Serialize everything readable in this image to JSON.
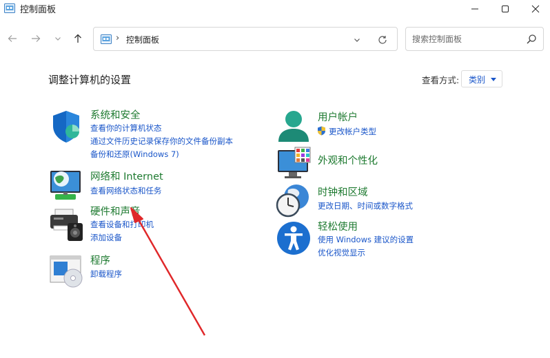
{
  "window": {
    "title": "控制面板",
    "controls": {
      "minimize_icon": "minimize-icon",
      "maximize_icon": "maximize-icon",
      "close_icon": "close-icon"
    }
  },
  "nav": {
    "address_path": "控制面板",
    "search_placeholder": "搜索控制面板"
  },
  "main": {
    "heading": "调整计算机的设置",
    "view_by_label": "查看方式:",
    "view_by_value": "类别"
  },
  "categories_left": [
    {
      "icon": "shield-icon",
      "title": "系统和安全",
      "links": [
        "查看你的计算机状态",
        "通过文件历史记录保存你的文件备份副本",
        "备份和还原(Windows 7)"
      ]
    },
    {
      "icon": "network-globe-icon",
      "title": "网络和 Internet",
      "links": [
        "查看网络状态和任务"
      ]
    },
    {
      "icon": "printer-speaker-icon",
      "title": "硬件和声音",
      "links": [
        "查看设备和打印机",
        "添加设备"
      ]
    },
    {
      "icon": "programs-disc-icon",
      "title": "程序",
      "links": [
        "卸载程序"
      ]
    }
  ],
  "categories_right": [
    {
      "icon": "user-account-icon",
      "title": "用户帐户",
      "links": [
        "更改帐户类型"
      ]
    },
    {
      "icon": "monitor-palette-icon",
      "title": "外观和个性化",
      "links": []
    },
    {
      "icon": "clock-globe-icon",
      "title": "时钟和区域",
      "links": [
        "更改日期、时间或数字格式"
      ]
    },
    {
      "icon": "accessibility-icon",
      "title": "轻松使用",
      "links": [
        "使用 Windows 建议的设置",
        "优化视觉显示"
      ]
    }
  ],
  "colors": {
    "category_title": "#1e7a30",
    "link": "#1a56c9",
    "annotation_arrow": "#e0282a"
  }
}
